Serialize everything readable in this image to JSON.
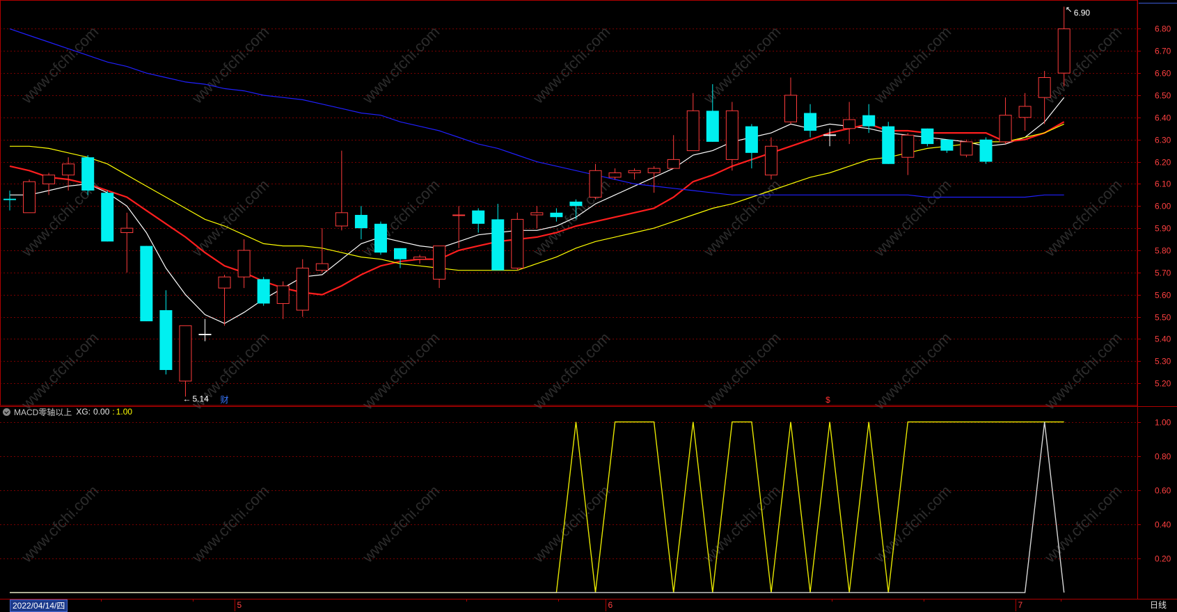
{
  "chart_data": {
    "type": "candlestick",
    "price_axis": {
      "ticks": [
        "6.80",
        "6.70",
        "6.60",
        "6.50",
        "6.40",
        "6.30",
        "6.20",
        "6.10",
        "6.00",
        "5.90",
        "5.80",
        "5.70",
        "5.60",
        "5.50",
        "5.40",
        "5.30",
        "5.20"
      ],
      "ylim": [
        5.1,
        6.93
      ]
    },
    "candles": [
      {
        "o": 6.03,
        "h": 6.07,
        "l": 5.98,
        "c": 6.03,
        "dir": "flat"
      },
      {
        "o": 5.97,
        "h": 6.12,
        "l": 5.97,
        "c": 6.11,
        "dir": "up"
      },
      {
        "o": 6.1,
        "h": 6.15,
        "l": 6.05,
        "c": 6.14,
        "dir": "up"
      },
      {
        "o": 6.14,
        "h": 6.22,
        "l": 6.07,
        "c": 6.19,
        "dir": "up"
      },
      {
        "o": 6.22,
        "h": 6.23,
        "l": 6.05,
        "c": 6.07,
        "dir": "down"
      },
      {
        "o": 6.06,
        "h": 6.07,
        "l": 5.84,
        "c": 5.84,
        "dir": "down"
      },
      {
        "o": 5.88,
        "h": 5.97,
        "l": 5.7,
        "c": 5.9,
        "dir": "up"
      },
      {
        "o": 5.82,
        "h": 5.82,
        "l": 5.48,
        "c": 5.48,
        "dir": "down"
      },
      {
        "o": 5.53,
        "h": 5.62,
        "l": 5.24,
        "c": 5.26,
        "dir": "down"
      },
      {
        "o": 5.21,
        "h": 5.46,
        "l": 5.14,
        "c": 5.46,
        "dir": "up"
      },
      {
        "o": 5.42,
        "h": 5.49,
        "l": 5.39,
        "c": 5.42,
        "dir": "flat"
      },
      {
        "o": 5.63,
        "h": 5.69,
        "l": 5.46,
        "c": 5.68,
        "dir": "up"
      },
      {
        "o": 5.68,
        "h": 5.85,
        "l": 5.63,
        "c": 5.8,
        "dir": "up"
      },
      {
        "o": 5.67,
        "h": 5.68,
        "l": 5.55,
        "c": 5.56,
        "dir": "down"
      },
      {
        "o": 5.56,
        "h": 5.66,
        "l": 5.49,
        "c": 5.64,
        "dir": "up"
      },
      {
        "o": 5.53,
        "h": 5.76,
        "l": 5.5,
        "c": 5.72,
        "dir": "up"
      },
      {
        "o": 5.71,
        "h": 5.9,
        "l": 5.7,
        "c": 5.74,
        "dir": "up"
      },
      {
        "o": 5.91,
        "h": 6.25,
        "l": 5.89,
        "c": 5.97,
        "dir": "up"
      },
      {
        "o": 5.96,
        "h": 6.0,
        "l": 5.85,
        "c": 5.9,
        "dir": "down"
      },
      {
        "o": 5.92,
        "h": 5.93,
        "l": 5.78,
        "c": 5.79,
        "dir": "down"
      },
      {
        "o": 5.81,
        "h": 5.81,
        "l": 5.72,
        "c": 5.76,
        "dir": "down"
      },
      {
        "o": 5.76,
        "h": 5.78,
        "l": 5.74,
        "c": 5.77,
        "dir": "up"
      },
      {
        "o": 5.67,
        "h": 5.82,
        "l": 5.63,
        "c": 5.82,
        "dir": "up"
      },
      {
        "o": 5.96,
        "h": 6.0,
        "l": 5.81,
        "c": 5.96,
        "dir": "up"
      },
      {
        "o": 5.98,
        "h": 5.99,
        "l": 5.88,
        "c": 5.92,
        "dir": "down"
      },
      {
        "o": 5.94,
        "h": 6.01,
        "l": 5.71,
        "c": 5.71,
        "dir": "down"
      },
      {
        "o": 5.72,
        "h": 5.97,
        "l": 5.71,
        "c": 5.94,
        "dir": "up"
      },
      {
        "o": 5.96,
        "h": 6.0,
        "l": 5.9,
        "c": 5.97,
        "dir": "up"
      },
      {
        "o": 5.97,
        "h": 5.99,
        "l": 5.93,
        "c": 5.95,
        "dir": "down"
      },
      {
        "o": 6.02,
        "h": 6.03,
        "l": 5.94,
        "c": 6.0,
        "dir": "down"
      },
      {
        "o": 6.04,
        "h": 6.19,
        "l": 6.03,
        "c": 6.16,
        "dir": "up"
      },
      {
        "o": 6.13,
        "h": 6.17,
        "l": 6.12,
        "c": 6.15,
        "dir": "up"
      },
      {
        "o": 6.15,
        "h": 6.17,
        "l": 6.12,
        "c": 6.16,
        "dir": "up"
      },
      {
        "o": 6.15,
        "h": 6.18,
        "l": 6.06,
        "c": 6.17,
        "dir": "up"
      },
      {
        "o": 6.17,
        "h": 6.32,
        "l": 6.17,
        "c": 6.21,
        "dir": "up"
      },
      {
        "o": 6.25,
        "h": 6.51,
        "l": 6.25,
        "c": 6.43,
        "dir": "up"
      },
      {
        "o": 6.43,
        "h": 6.55,
        "l": 6.29,
        "c": 6.29,
        "dir": "down"
      },
      {
        "o": 6.21,
        "h": 6.47,
        "l": 6.16,
        "c": 6.43,
        "dir": "up"
      },
      {
        "o": 6.36,
        "h": 6.37,
        "l": 6.17,
        "c": 6.24,
        "dir": "down"
      },
      {
        "o": 6.14,
        "h": 6.31,
        "l": 6.12,
        "c": 6.27,
        "dir": "up"
      },
      {
        "o": 6.38,
        "h": 6.58,
        "l": 6.37,
        "c": 6.5,
        "dir": "up"
      },
      {
        "o": 6.42,
        "h": 6.46,
        "l": 6.31,
        "c": 6.34,
        "dir": "down"
      },
      {
        "o": 6.33,
        "h": 6.35,
        "l": 6.27,
        "c": 6.32,
        "dir": "flat"
      },
      {
        "o": 6.35,
        "h": 6.47,
        "l": 6.28,
        "c": 6.39,
        "dir": "up"
      },
      {
        "o": 6.41,
        "h": 6.46,
        "l": 6.33,
        "c": 6.36,
        "dir": "down"
      },
      {
        "o": 6.36,
        "h": 6.38,
        "l": 6.19,
        "c": 6.19,
        "dir": "down"
      },
      {
        "o": 6.22,
        "h": 6.33,
        "l": 6.14,
        "c": 6.32,
        "dir": "up"
      },
      {
        "o": 6.35,
        "h": 6.35,
        "l": 6.27,
        "c": 6.28,
        "dir": "down"
      },
      {
        "o": 6.3,
        "h": 6.3,
        "l": 6.24,
        "c": 6.25,
        "dir": "down"
      },
      {
        "o": 6.23,
        "h": 6.3,
        "l": 6.22,
        "c": 6.29,
        "dir": "up"
      },
      {
        "o": 6.3,
        "h": 6.31,
        "l": 6.19,
        "c": 6.2,
        "dir": "down"
      },
      {
        "o": 6.29,
        "h": 6.49,
        "l": 6.28,
        "c": 6.41,
        "dir": "up"
      },
      {
        "o": 6.4,
        "h": 6.51,
        "l": 6.34,
        "c": 6.45,
        "dir": "up"
      },
      {
        "o": 6.49,
        "h": 6.61,
        "l": 6.37,
        "c": 6.58,
        "dir": "up"
      },
      {
        "o": 6.6,
        "h": 6.9,
        "l": 6.54,
        "c": 6.8,
        "dir": "up"
      }
    ],
    "moving_averages": [
      {
        "name": "ma5",
        "color": "#ffffff",
        "values": [
          6.05,
          6.05,
          6.07,
          6.09,
          6.1,
          6.06,
          6.0,
          5.88,
          5.72,
          5.6,
          5.51,
          5.47,
          5.52,
          5.58,
          5.63,
          5.68,
          5.69,
          5.76,
          5.83,
          5.86,
          5.84,
          5.82,
          5.81,
          5.84,
          5.87,
          5.88,
          5.89,
          5.89,
          5.91,
          5.95,
          6.01,
          6.05,
          6.09,
          6.13,
          6.17,
          6.23,
          6.25,
          6.29,
          6.31,
          6.33,
          6.37,
          6.35,
          6.37,
          6.36,
          6.35,
          6.33,
          6.32,
          6.31,
          6.3,
          6.29,
          6.27,
          6.28,
          6.31,
          6.38,
          6.49
        ]
      },
      {
        "name": "ma10",
        "color": "#ff1e1e",
        "values": [
          6.18,
          6.16,
          6.13,
          6.12,
          6.1,
          6.07,
          6.04,
          5.98,
          5.92,
          5.86,
          5.79,
          5.73,
          5.7,
          5.66,
          5.63,
          5.61,
          5.6,
          5.64,
          5.69,
          5.73,
          5.75,
          5.76,
          5.76,
          5.8,
          5.82,
          5.84,
          5.85,
          5.86,
          5.88,
          5.91,
          5.93,
          5.95,
          5.97,
          5.99,
          6.04,
          6.11,
          6.14,
          6.18,
          6.21,
          6.24,
          6.27,
          6.3,
          6.33,
          6.35,
          6.37,
          6.34,
          6.34,
          6.33,
          6.33,
          6.33,
          6.33,
          6.29,
          6.3,
          6.33,
          6.38
        ]
      },
      {
        "name": "ma20",
        "color": "#ffff00",
        "values": [
          6.27,
          6.27,
          6.26,
          6.24,
          6.22,
          6.19,
          6.14,
          6.09,
          6.04,
          5.99,
          5.94,
          5.91,
          5.87,
          5.83,
          5.82,
          5.82,
          5.81,
          5.79,
          5.77,
          5.76,
          5.74,
          5.73,
          5.72,
          5.71,
          5.71,
          5.71,
          5.71,
          5.74,
          5.77,
          5.81,
          5.84,
          5.86,
          5.88,
          5.9,
          5.93,
          5.96,
          5.99,
          6.01,
          6.04,
          6.07,
          6.1,
          6.13,
          6.15,
          6.18,
          6.21,
          6.22,
          6.24,
          6.26,
          6.27,
          6.28,
          6.29,
          6.29,
          6.31,
          6.33,
          6.37
        ]
      },
      {
        "name": "ma60",
        "color": "#2020ff",
        "values": [
          6.8,
          6.77,
          6.74,
          6.71,
          6.68,
          6.65,
          6.63,
          6.6,
          6.58,
          6.56,
          6.55,
          6.53,
          6.52,
          6.5,
          6.49,
          6.48,
          6.46,
          6.44,
          6.42,
          6.41,
          6.38,
          6.36,
          6.34,
          6.31,
          6.28,
          6.26,
          6.23,
          6.2,
          6.18,
          6.16,
          6.14,
          6.12,
          6.1,
          6.09,
          6.08,
          6.07,
          6.06,
          6.05,
          6.05,
          6.05,
          6.05,
          6.05,
          6.05,
          6.05,
          6.05,
          6.05,
          6.05,
          6.04,
          6.04,
          6.04,
          6.04,
          6.04,
          6.04,
          6.05,
          6.05
        ]
      }
    ],
    "annotations": {
      "high_label": "6.90",
      "low_label": "5.14",
      "low_arrow": "←",
      "event_marks": [
        {
          "index": 11,
          "text": "财",
          "color": "#3a78ff"
        },
        {
          "index": 42,
          "text": "$",
          "color": "#ff3030"
        }
      ]
    },
    "indicator": {
      "name": "MACD零轴以上",
      "xg_label": "XG:",
      "value1": "0.00",
      "separator": ":",
      "value2": "1.00",
      "axis_ticks": [
        "1.00",
        "0.80",
        "0.60",
        "0.40",
        "0.20"
      ],
      "ylim": [
        -0.02,
        1.06
      ],
      "yellow_line": [
        0,
        0,
        0,
        0,
        0,
        0,
        0,
        0,
        0,
        0,
        0,
        0,
        0,
        0,
        0,
        0,
        0,
        0,
        0,
        0,
        0,
        0,
        0,
        0,
        0,
        0,
        0,
        0,
        0,
        1,
        0,
        1,
        1,
        1,
        0,
        1,
        0,
        1,
        1,
        0,
        1,
        0,
        1,
        0,
        1,
        0,
        1,
        1,
        1,
        1,
        1,
        1,
        1,
        1,
        1
      ],
      "white_line": [
        0,
        0,
        0,
        0,
        0,
        0,
        0,
        0,
        0,
        0,
        0,
        0,
        0,
        0,
        0,
        0,
        0,
        0,
        0,
        0,
        0,
        0,
        0,
        0,
        0,
        0,
        0,
        0,
        0,
        0,
        0,
        0,
        0,
        0,
        0,
        0,
        0,
        0,
        0,
        0,
        0,
        0,
        0,
        0,
        0,
        0,
        0,
        0,
        0,
        0,
        0,
        0,
        0,
        1,
        0
      ]
    },
    "x_axis": {
      "date_label": "2022/04/14/四",
      "month_marks": [
        {
          "index": 12,
          "text": "5"
        },
        {
          "index": 31,
          "text": "6"
        },
        {
          "index": 52,
          "text": "7"
        }
      ],
      "period": "日线"
    },
    "colors": {
      "background": "#000000",
      "grid": "#7a0000",
      "frame": "#b00000",
      "up": "#ff3c3c",
      "down": "#00f0f0",
      "axis_text": "#ff4040",
      "watermark": "#505050"
    },
    "watermark": "www.cfchi.com"
  }
}
